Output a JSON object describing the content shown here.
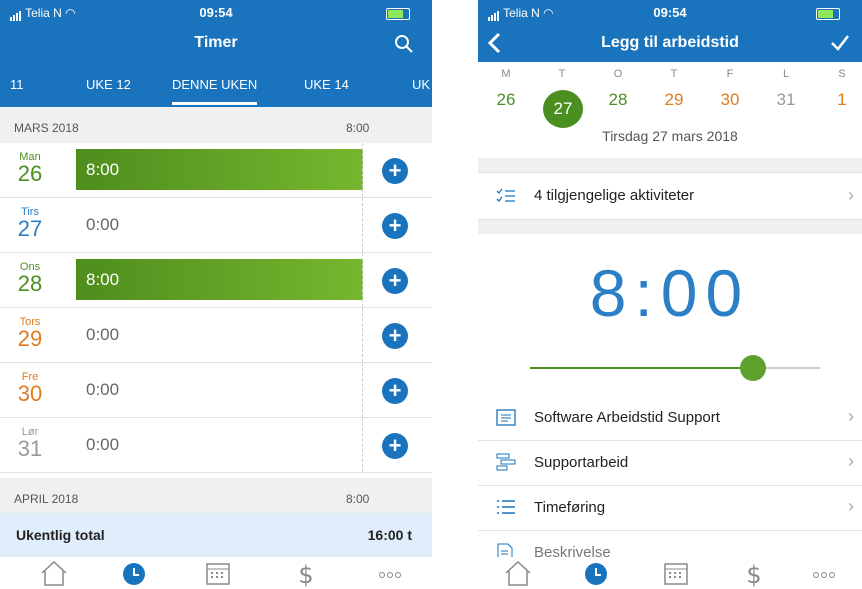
{
  "left": {
    "status": {
      "carrier": "Telia N",
      "time": "09:54"
    },
    "title": "Timer",
    "tabs": [
      "11",
      "UKE 12",
      "DENNE UKEN",
      "UKE 14",
      "UK"
    ],
    "month1": {
      "label": "MARS 2018",
      "hours": "8:00"
    },
    "days": [
      {
        "name": "Man",
        "date": "26",
        "hours": "8:00",
        "filled": true,
        "color": "#4a8f1f"
      },
      {
        "name": "Tirs",
        "date": "27",
        "hours": "0:00",
        "filled": false,
        "color": "#2a7fc6"
      },
      {
        "name": "Ons",
        "date": "28",
        "hours": "8:00",
        "filled": true,
        "color": "#4a8f1f"
      },
      {
        "name": "Tors",
        "date": "29",
        "hours": "0:00",
        "filled": false,
        "color": "#e07b22"
      },
      {
        "name": "Fre",
        "date": "30",
        "hours": "0:00",
        "filled": false,
        "color": "#e07b22"
      },
      {
        "name": "Lør",
        "date": "31",
        "hours": "0:00",
        "filled": false,
        "color": "#999999"
      }
    ],
    "month2": {
      "label": "APRIL 2018",
      "hours": "8:00"
    },
    "total": {
      "label": "Ukentlig total",
      "value": "16:00 t"
    }
  },
  "right": {
    "status": {
      "carrier": "Telia N",
      "time": "09:54"
    },
    "title": "Legg til arbeidstid",
    "weekday_letters": [
      "M",
      "T",
      "O",
      "T",
      "F",
      "L",
      "S"
    ],
    "week_dates": [
      {
        "d": "26",
        "color": "#4a8f1f"
      },
      {
        "d": "27",
        "color": "#ffffff"
      },
      {
        "d": "28",
        "color": "#4a8f1f"
      },
      {
        "d": "29",
        "color": "#e07b22"
      },
      {
        "d": "30",
        "color": "#e07b22"
      },
      {
        "d": "31",
        "color": "#999999"
      },
      {
        "d": "1",
        "color": "#e07b22"
      }
    ],
    "selected_date": "Tirsdag 27 mars 2018",
    "activities": "4 tilgjengelige aktiviteter",
    "time": "8:00",
    "slider_fraction": 0.77,
    "items": [
      "Software Arbeidstid Support",
      "Supportarbeid",
      "Timeføring",
      "Beskrivelse"
    ]
  },
  "colors": {
    "header": "#1a73bd",
    "accent_green": "#4a8f1f",
    "accent_blue": "#2a7fc6"
  }
}
